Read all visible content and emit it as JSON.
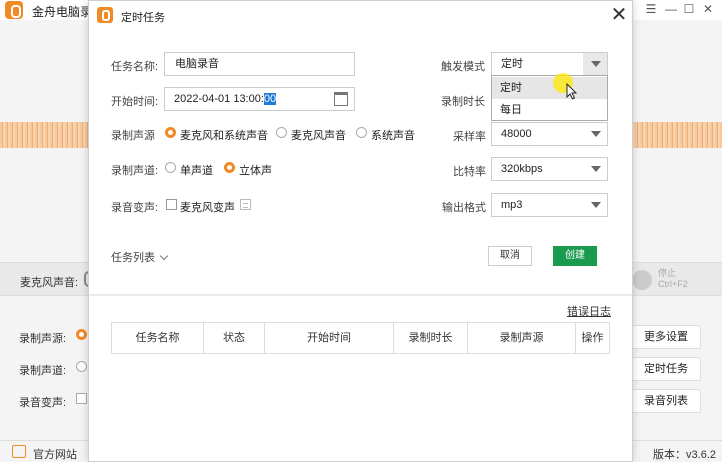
{
  "app": {
    "title": "金舟电脑录",
    "mic_volume_label": "麦克风声音:",
    "stop_hint": "停止",
    "stop_shortcut": "Ctrl+F2",
    "left_rows": [
      "录制声源:",
      "录制声道:",
      "录音变声:"
    ],
    "right_buttons": [
      "更多设置",
      "定时任务",
      "录音列表"
    ],
    "footer_site": "官方网站",
    "version": "版本：v3.6.2",
    "accent_color": "#f08a24"
  },
  "dialog": {
    "title": "定时任务",
    "task_name": {
      "label": "任务名称:",
      "value": "电脑录音"
    },
    "start_time": {
      "label": "开始时间:",
      "value_prefix": "2022-04-01 13:00:",
      "value_selected": "00"
    },
    "source": {
      "label": "录制声源",
      "options": [
        "麦克风和系统声音",
        "麦克风声音",
        "系统声音"
      ],
      "selected": 0
    },
    "channel": {
      "label": "录制声道:",
      "options": [
        "单声道",
        "立体声"
      ],
      "selected": 1
    },
    "voice_change": {
      "label": "录音变声:",
      "checkbox_label": "麦克风变声",
      "checked": false
    },
    "trigger_mode": {
      "label": "触发模式",
      "value": "定时",
      "options": [
        "定时",
        "每日"
      ],
      "highlighted": 0
    },
    "duration": {
      "label": "录制时长"
    },
    "sample_rate": {
      "label": "采样率",
      "value": "48000"
    },
    "bitrate": {
      "label": "比特率",
      "value": "320kbps"
    },
    "output_format": {
      "label": "输出格式",
      "value": "mp3"
    },
    "task_list_toggle": "任务列表",
    "cancel_label": "取消",
    "create_label": "创建",
    "error_log_link": "错误日志",
    "table_headers": [
      "任务名称",
      "状态",
      "开始时间",
      "录制时长",
      "录制声源",
      "操作"
    ],
    "table_rows": [],
    "create_color": "#1a9a4e"
  }
}
